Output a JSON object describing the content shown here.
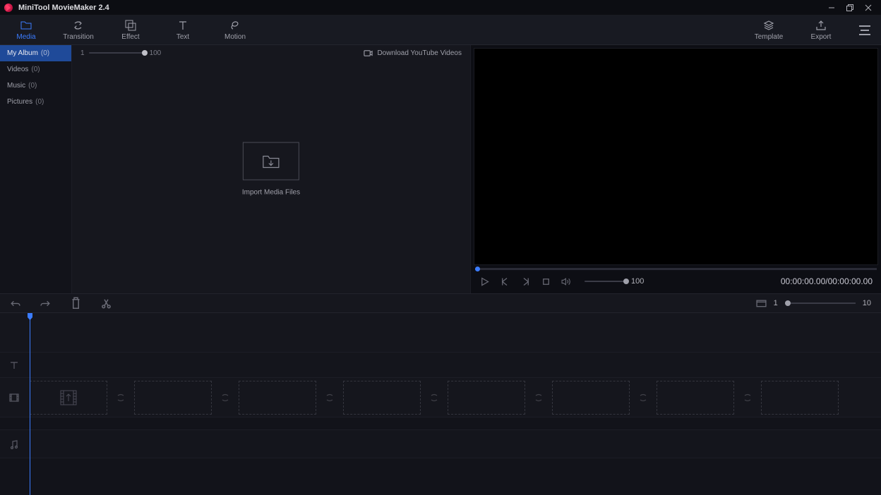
{
  "app": {
    "title": "MiniTool MovieMaker 2.4"
  },
  "toolbar": [
    {
      "label": "Media",
      "active": true
    },
    {
      "label": "Transition",
      "active": false
    },
    {
      "label": "Effect",
      "active": false
    },
    {
      "label": "Text",
      "active": false
    },
    {
      "label": "Motion",
      "active": false
    }
  ],
  "toolbar_right": [
    {
      "label": "Template"
    },
    {
      "label": "Export"
    }
  ],
  "sidebar": {
    "items": [
      {
        "label": "My Album",
        "count": "(0)",
        "active": true
      },
      {
        "label": "Videos",
        "count": "(0)",
        "active": false
      },
      {
        "label": "Music",
        "count": "(0)",
        "active": false
      },
      {
        "label": "Pictures",
        "count": "(0)",
        "active": false
      }
    ]
  },
  "media": {
    "thumb_min": "1",
    "thumb_max": "100",
    "download_label": "Download YouTube Videos",
    "import_label": "Import Media Files"
  },
  "player": {
    "volume": "100",
    "timecode": "00:00:00.00/00:00:00.00"
  },
  "timeline_tools": {
    "zoom_min": "1",
    "zoom_max": "10"
  }
}
